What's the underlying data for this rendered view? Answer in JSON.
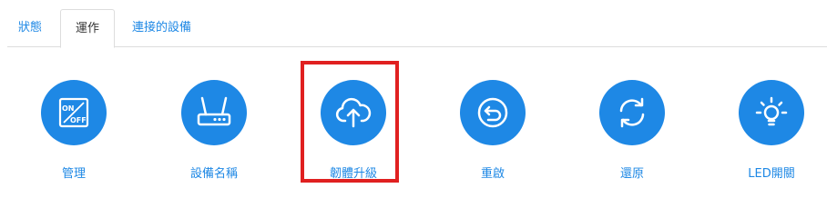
{
  "tabs": [
    {
      "label": "狀態",
      "active": false
    },
    {
      "label": "運作",
      "active": true
    },
    {
      "label": "連接的設備",
      "active": false
    }
  ],
  "actions": [
    {
      "label": "管理",
      "icon": "on-off-switch-icon"
    },
    {
      "label": "設備名稱",
      "icon": "router-icon"
    },
    {
      "label": "韌體升級",
      "icon": "cloud-upload-icon",
      "highlighted": true
    },
    {
      "label": "重啟",
      "icon": "restart-icon"
    },
    {
      "label": "還原",
      "icon": "refresh-icon"
    },
    {
      "label": "LED開關",
      "icon": "lightbulb-icon"
    }
  ],
  "icon_text": {
    "on": "ON",
    "off": "OFF"
  },
  "colors": {
    "accent": "#1e88e5",
    "highlight_border": "#e02020",
    "active_tab_text": "#333333"
  }
}
